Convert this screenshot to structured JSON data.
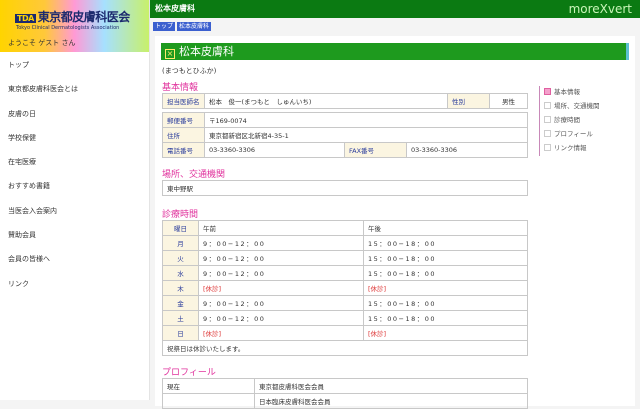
{
  "logo": {
    "text": "東京都皮膚科医会",
    "mark": "TDA",
    "sub": "Tokyo Clinical Dermatologists Association"
  },
  "welcome": "ようこそ ゲスト さん",
  "sidebar": [
    "トップ",
    "東京都皮膚科医会とは",
    "皮膚の日",
    "学校保健",
    "在宅医療",
    "おすすめ書籍",
    "当医会入会案内",
    "賛助会員",
    "会員の皆様へ",
    "リンク"
  ],
  "header": {
    "title": "松本皮膚科",
    "brand": "moreXvert"
  },
  "breadcrumb": [
    "トップ",
    "松本皮膚科"
  ],
  "page": {
    "title": "松本皮膚科",
    "kana": "(まつもとひふか)"
  },
  "basic": {
    "heading": "基本情報",
    "doctor_label": "担当医師名",
    "doctor": "松本　俊一(まつもと　しゅんいち)",
    "sex_label": "性別",
    "sex": "男性",
    "zip_label": "郵便番号",
    "zip": "〒169-0074",
    "addr_label": "住所",
    "addr": "東京都新宿区北新宿4-35-1",
    "tel_label": "電話番号",
    "tel": "03-3360-3306",
    "fax_label": "FAX番号",
    "fax": "03-3360-3306"
  },
  "access": {
    "heading": "場所、交通機関",
    "text": "東中野駅"
  },
  "hours": {
    "heading": "診療時間",
    "cols": [
      "曜日",
      "午前",
      "午後"
    ],
    "rows": [
      [
        "月",
        "9：00−12：00",
        "15：00−18：00"
      ],
      [
        "火",
        "9：00−12：00",
        "15：00−18：00"
      ],
      [
        "水",
        "9：00−12：00",
        "15：00−18：00"
      ],
      [
        "木",
        "[休診]",
        "[休診]"
      ],
      [
        "金",
        "9：00−12：00",
        "15：00−18：00"
      ],
      [
        "土",
        "9：00−12：00",
        "15：00−18：00"
      ],
      [
        "日",
        "[休診]",
        "[休診]"
      ]
    ],
    "note": "祝祭日は休診いたします。"
  },
  "profile": {
    "heading": "プロフィール",
    "rows": [
      [
        "現在",
        "東京都皮膚科医会会員"
      ],
      [
        "",
        "日本臨床皮膚科医会会員"
      ]
    ]
  },
  "rightnav": [
    "基本情報",
    "場所、交通機関",
    "診療時間",
    "プロフィール",
    "リンク情報"
  ]
}
